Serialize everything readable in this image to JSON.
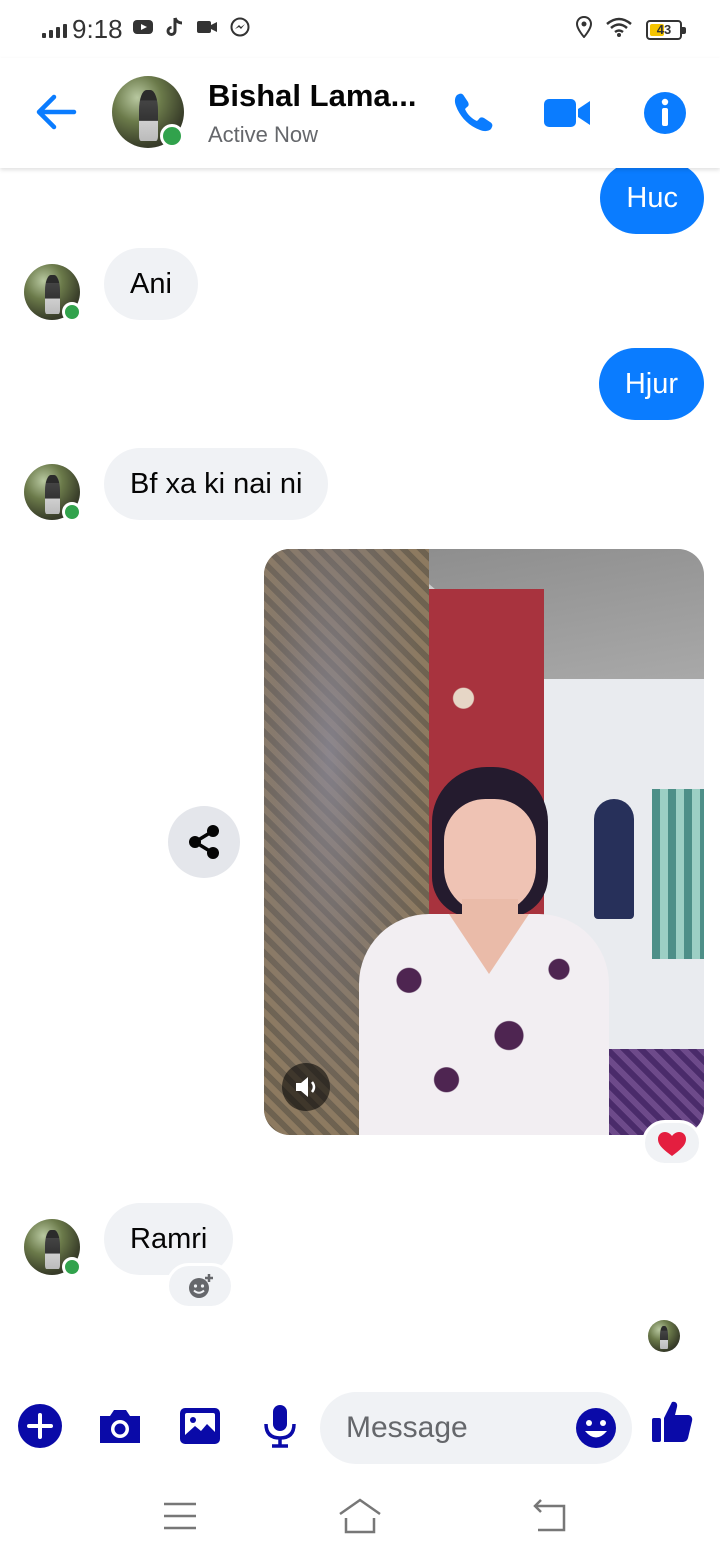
{
  "status_bar": {
    "time": "9:18",
    "battery": "43",
    "app_icons": [
      "youtube-icon",
      "tiktok-icon",
      "video-icon",
      "messenger-icon"
    ],
    "right_icons": [
      "location-icon",
      "wifi-icon",
      "battery-icon"
    ]
  },
  "header": {
    "contact_name": "Bishal Lama...",
    "status": "Active Now",
    "online": true
  },
  "messages": [
    {
      "sender": "me",
      "text": "Huc"
    },
    {
      "sender": "contact",
      "text": "Ani"
    },
    {
      "sender": "me",
      "text": "Hjur"
    },
    {
      "sender": "contact",
      "text": "Bf xa ki nai ni"
    },
    {
      "sender": "me",
      "type": "video",
      "reaction": "heart"
    },
    {
      "sender": "contact",
      "text": "Ramri"
    }
  ],
  "composer": {
    "placeholder": "Message"
  },
  "colors": {
    "accent": "#0a7cff",
    "composer_icons": "#0a0aa8",
    "incoming_bubble": "#f0f2f5",
    "online": "#31a24c"
  }
}
